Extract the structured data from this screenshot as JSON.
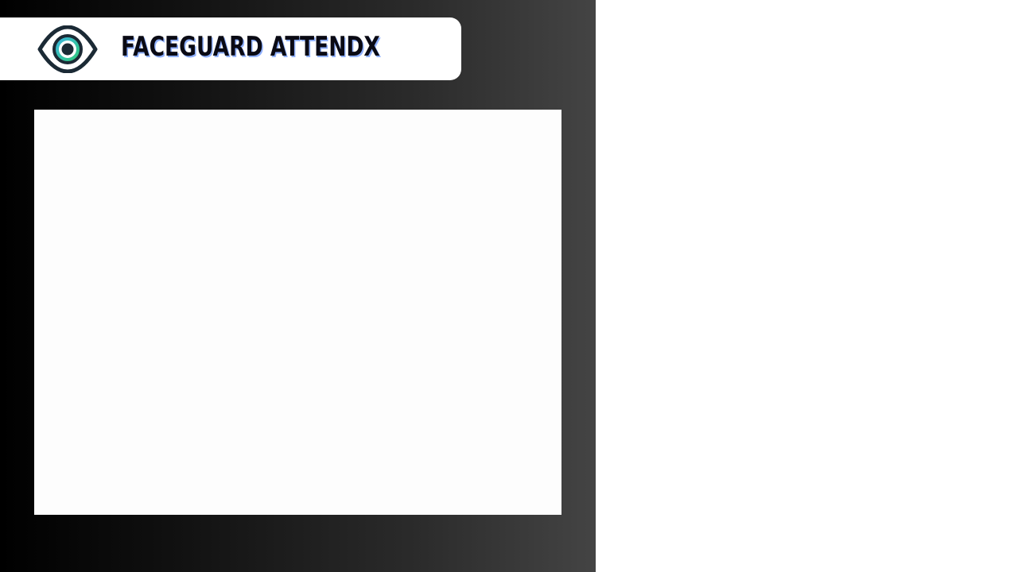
{
  "app": {
    "title": "FACEGUARD ATTENDX",
    "logo_icon": "eye-icon"
  },
  "colors": {
    "panel_gradient_start": "#000000",
    "panel_gradient_end": "#444444",
    "header_bg": "#ffffff",
    "title_text": "#0a0a14",
    "title_shadow": "#8fb0ff",
    "logo_outer": "#1b2a35",
    "logo_iris_green": "#2ecc71",
    "logo_iris_blue": "#3db4e8"
  }
}
